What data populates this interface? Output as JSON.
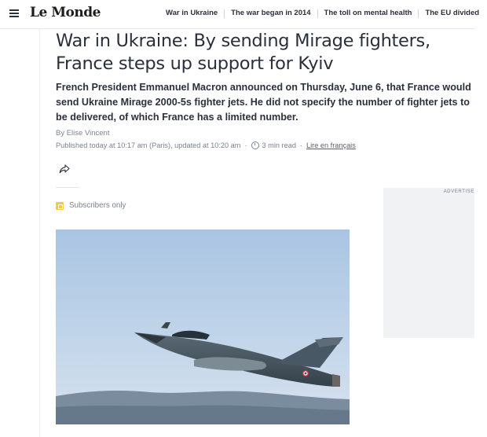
{
  "header": {
    "logo": "Le Monde",
    "nav": [
      "War in Ukraine",
      "The war began in 2014",
      "The toll on mental health",
      "The EU divided"
    ]
  },
  "article": {
    "headline": "War in Ukraine: By sending Mirage fighters, France steps up support for Kyiv",
    "standfirst": "French President Emmanuel Macron announced on Thursday, June 6, that France would send Ukraine Mirage 2000-5s fighter jets. He did not specify the number of fighter jets to be delivered, of which France has a limited number.",
    "byline": "By Elise Vincent",
    "published": "Published today at 10:17 am (Paris), updated at 10:20 am",
    "read_time": "3 min read",
    "lire": "Lire en français",
    "subscribers": "Subscribers only"
  },
  "ad": {
    "label": "ADVERTISE"
  },
  "icons": {
    "menu": "hamburger-icon",
    "share": "share-icon",
    "clock": "clock-icon",
    "subscriber": "subscriber-badge-icon"
  },
  "colors": {
    "text": "#2a303b",
    "muted": "#7a8191",
    "badge": "#f7c948",
    "ad_bg": "#f1f2f4"
  }
}
